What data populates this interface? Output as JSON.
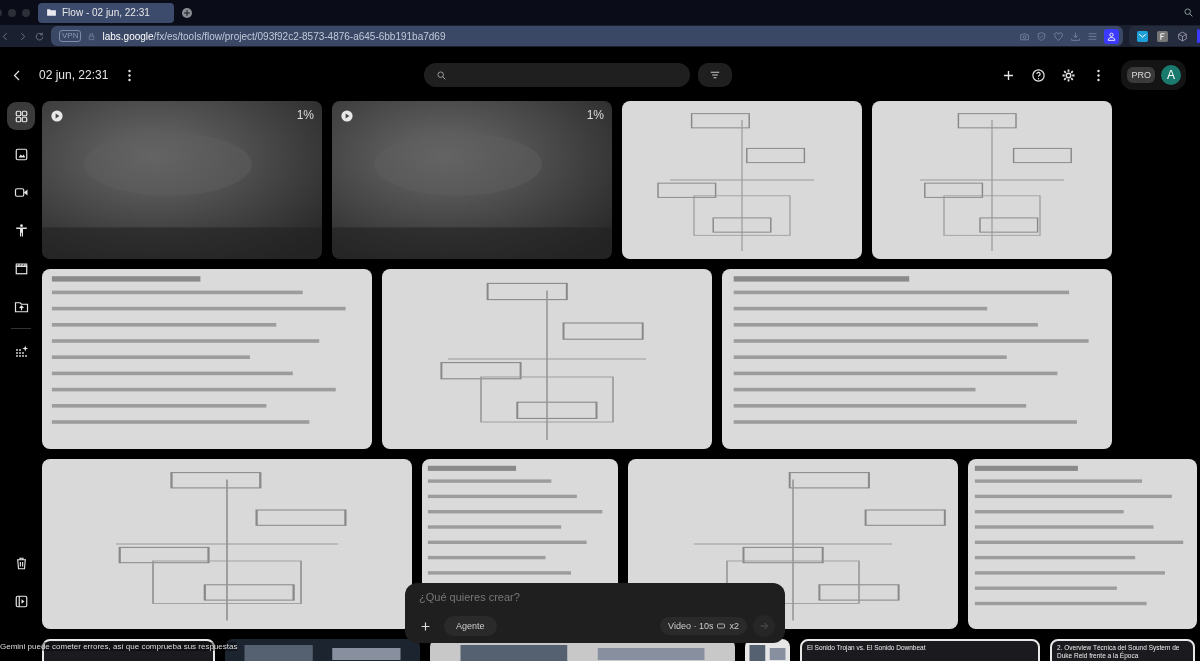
{
  "browser": {
    "tab": {
      "title": "Flow - 02 jun, 22:31",
      "selected": true
    },
    "address": {
      "vpn_badge": "VPN",
      "url": "**labs.google**/fx/es/tools/flow/project/093f92c2-8573-4876-a645-6bb191ba7d69"
    }
  },
  "header": {
    "title": "02 jun, 22:31",
    "plan_badge": "PRO",
    "avatar_letter": "A"
  },
  "sidebar": {
    "items": [
      {
        "selected": true
      },
      {
        "selected": false
      },
      {
        "selected": false
      },
      {
        "selected": false
      },
      {
        "selected": false
      },
      {
        "selected": false
      },
      {
        "selected": false
      }
    ],
    "bottom_items": [
      {
        "selected": false
      },
      {
        "selected": false
      }
    ]
  },
  "gallery": {
    "rows": [
      [
        {
          "kind": "video",
          "progress": "1%"
        },
        {
          "kind": "video",
          "progress": "1%"
        },
        {
          "kind": "diagram"
        },
        {
          "kind": "diagram"
        }
      ],
      [
        {
          "kind": "document"
        },
        {
          "kind": "diagram"
        },
        {
          "kind": "document"
        }
      ],
      [
        {
          "kind": "diagram"
        },
        {
          "kind": "document"
        },
        {
          "kind": "diagram"
        },
        {
          "kind": "document"
        }
      ],
      [
        {
          "kind": "dark-card"
        },
        {
          "kind": "picture"
        },
        {
          "kind": "picture"
        },
        {
          "kind": "picture"
        },
        {
          "kind": "text-card",
          "title": "El Sonido Trojan vs. El Sonido Downbeat"
        },
        {
          "kind": "text-card",
          "title": "2. Overview Técnica del Sound System de Duke Reid frente a la Época"
        }
      ]
    ]
  },
  "disclaimer": "Gemini puede cometer errores, así que comprueba sus respuestas",
  "prompt": {
    "placeholder": "¿Qué quieres crear?",
    "mode_button": "Agente",
    "video_setting": "Video · 10s",
    "count": "x2",
    "send_disabled": true
  }
}
